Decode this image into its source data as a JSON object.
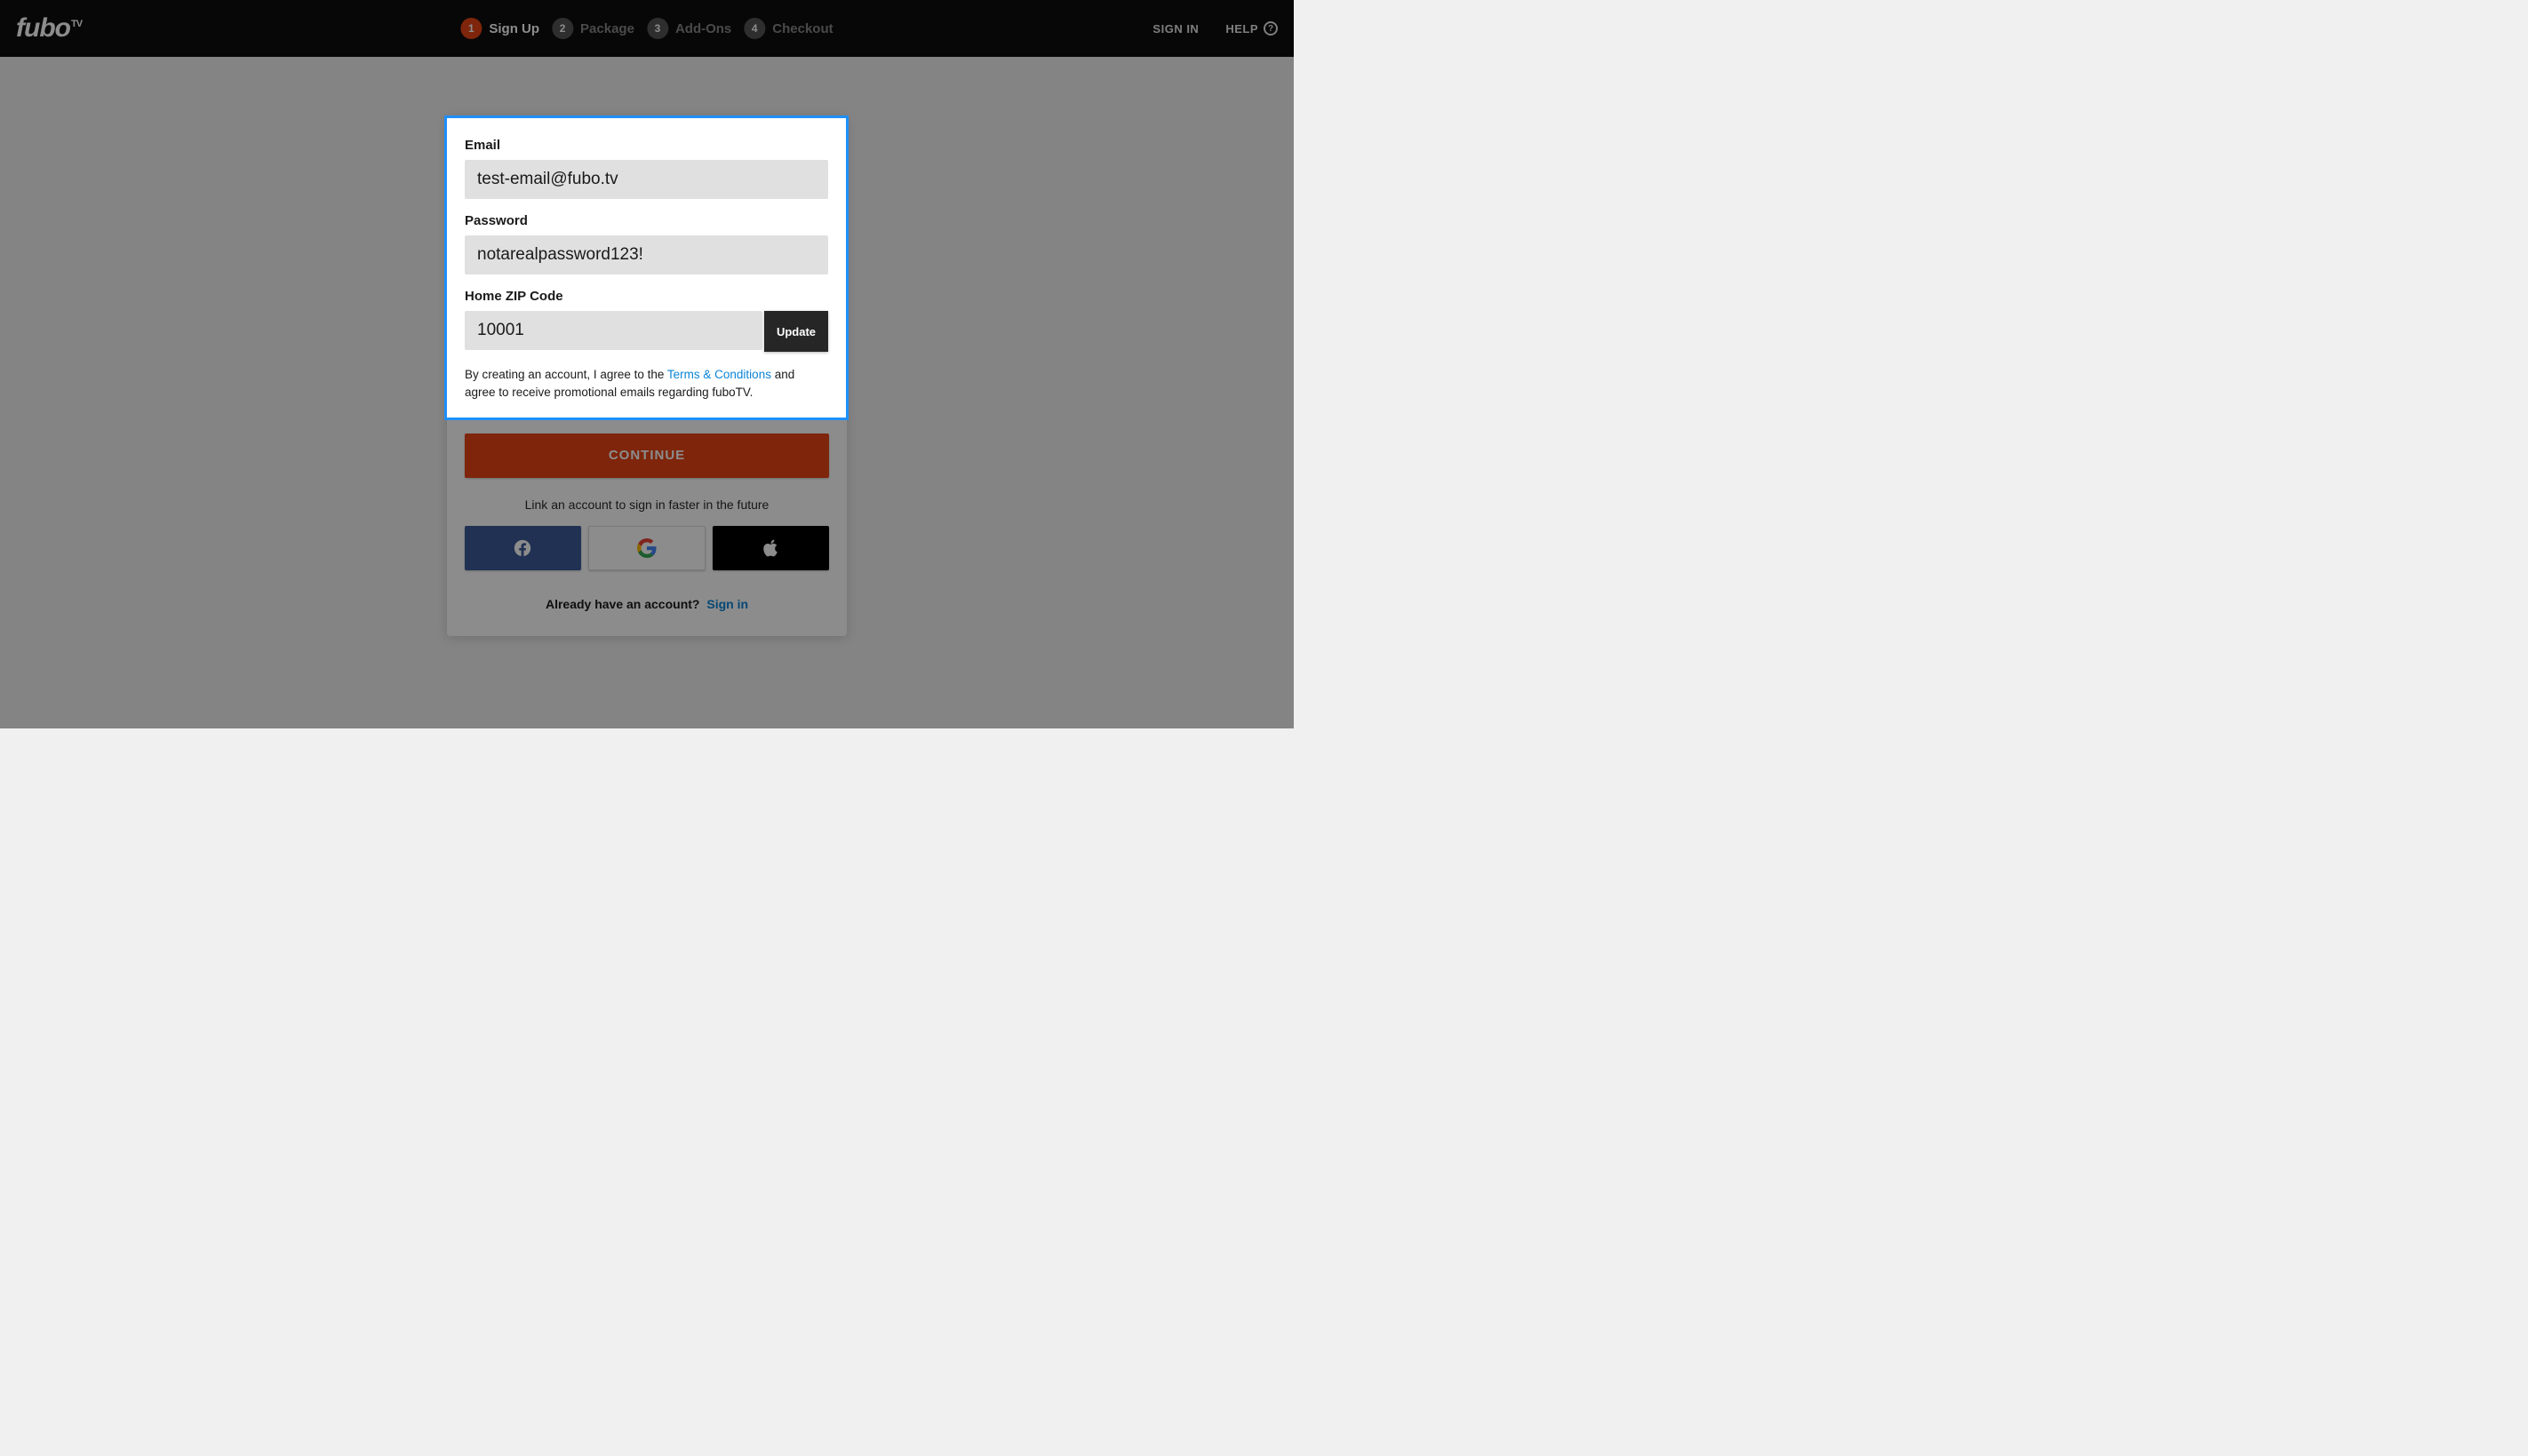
{
  "header": {
    "logo_text": "fubo",
    "logo_suffix": "TV",
    "sign_in": "SIGN IN",
    "help": "HELP"
  },
  "steps": [
    {
      "num": "1",
      "label": "Sign Up",
      "active": true
    },
    {
      "num": "2",
      "label": "Package",
      "active": false
    },
    {
      "num": "3",
      "label": "Add-Ons",
      "active": false
    },
    {
      "num": "4",
      "label": "Checkout",
      "active": false
    }
  ],
  "form": {
    "email_label": "Email",
    "email_value": "test-email@fubo.tv",
    "password_label": "Password",
    "password_value": "notarealpassword123!",
    "zip_label": "Home ZIP Code",
    "zip_value": "10001",
    "update_label": "Update",
    "legal_pre": "By creating an account, I agree to the ",
    "legal_link": "Terms & Conditions",
    "legal_post": " and agree to receive promotional emails regarding fuboTV.",
    "continue_label": "CONTINUE",
    "link_account_text": "Link an account to sign in faster in the future",
    "already_text": "Already have an account?",
    "sign_in_link": "Sign in"
  },
  "colors": {
    "accent": "#e64415",
    "link": "#0a84d6",
    "highlight": "#1e90ff"
  }
}
